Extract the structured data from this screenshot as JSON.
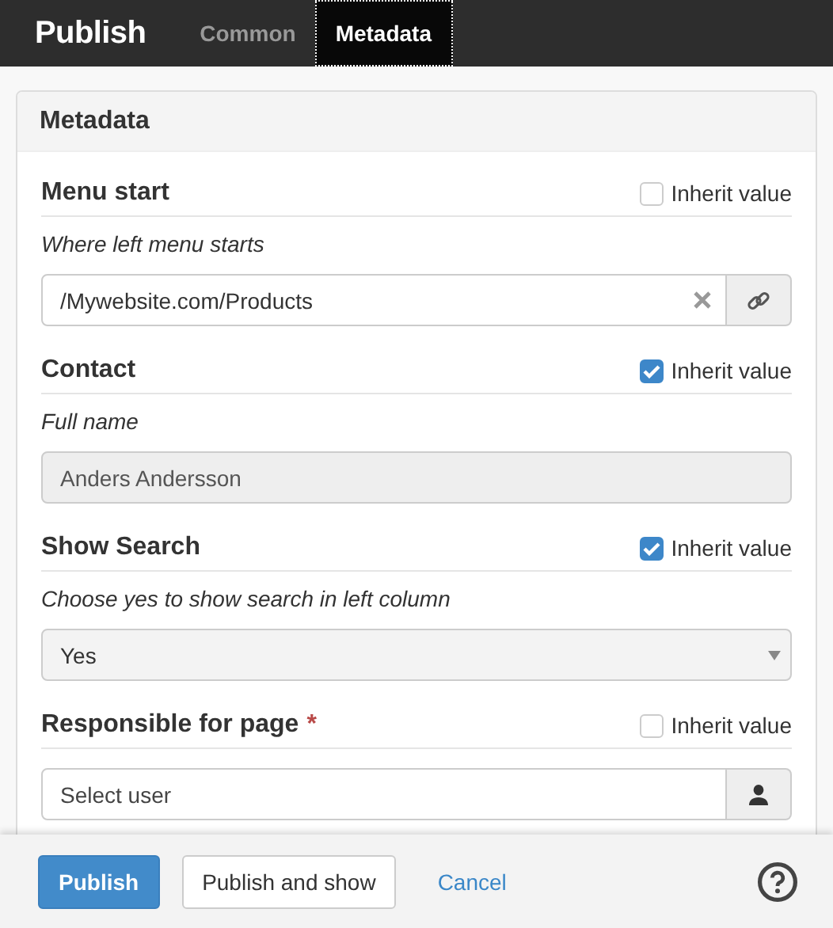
{
  "top_bar": {
    "title": "Publish",
    "tabs": [
      {
        "label": "Common",
        "selected": false
      },
      {
        "label": "Metadata",
        "selected": true
      }
    ]
  },
  "panel": {
    "title": "Metadata",
    "fields": [
      {
        "kind": "link",
        "label": "Menu start",
        "inherit_label": "Inherit value",
        "inherit": false,
        "description": "Where left menu starts",
        "value": "/Mywebsite.com/Products",
        "disabled": false
      },
      {
        "kind": "text",
        "label": "Contact",
        "inherit_label": "Inherit value",
        "inherit": true,
        "description": "Full name",
        "value": "Anders Andersson",
        "disabled": true
      },
      {
        "kind": "select",
        "label": "Show Search",
        "inherit_label": "Inherit value",
        "inherit": true,
        "description": "Choose yes to show search in left column",
        "value": "Yes",
        "disabled": false
      },
      {
        "kind": "user",
        "label": "Responsible for page",
        "required_mark": "*",
        "inherit_label": "Inherit value",
        "inherit": false,
        "placeholder": "Select user",
        "disabled": false
      }
    ]
  },
  "footer": {
    "publish": "Publish",
    "publish_and_show": "Publish and show",
    "cancel": "Cancel"
  }
}
